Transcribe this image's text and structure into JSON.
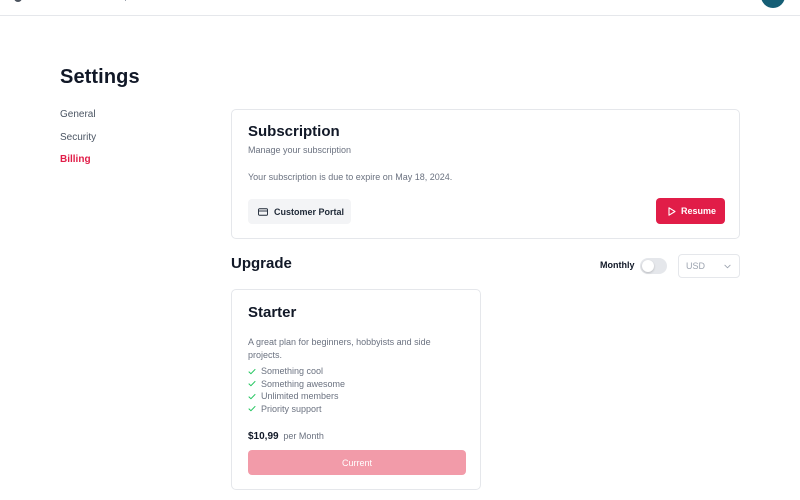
{
  "page": {
    "title": "Settings"
  },
  "sidebar": {
    "items": [
      {
        "label": "General",
        "active": false
      },
      {
        "label": "Security",
        "active": false
      },
      {
        "label": "Billing",
        "active": true
      }
    ]
  },
  "subscription": {
    "title": "Subscription",
    "description": "Manage your subscription",
    "expiry_text": "Your subscription is due to expire on May 18, 2024.",
    "portal_button": {
      "label": "Customer Portal",
      "icon": "credit-card-icon"
    },
    "resume_button": {
      "label": "Resume",
      "icon": "play-icon"
    }
  },
  "upgrade": {
    "title": "Upgrade",
    "billing_toggle": {
      "label": "Monthly",
      "on": false
    },
    "currency": {
      "value": "USD"
    }
  },
  "plans": [
    {
      "name": "Starter",
      "description": "A great plan for beginners, hobbyists and side projects.",
      "features": [
        "Something cool",
        "Something awesome",
        "Unlimited members",
        "Priority support"
      ],
      "price": "$10,99",
      "period": "per Month",
      "button_label": "Current"
    }
  ],
  "colors": {
    "accent": "#e11d48",
    "accent_muted": "#f29ba9",
    "check": "#22c55e",
    "avatar": "#155e75"
  }
}
